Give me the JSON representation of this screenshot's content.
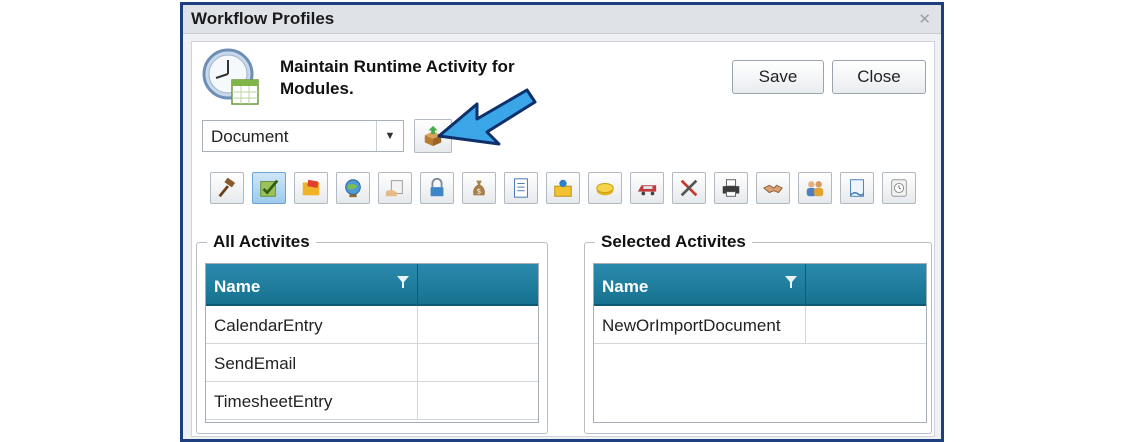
{
  "window": {
    "title": "Workflow Profiles",
    "close_symbol": "✕"
  },
  "header": {
    "title": "Maintain Runtime Activity for Modules."
  },
  "buttons": {
    "save": "Save",
    "close": "Close"
  },
  "module_select": {
    "value": "Document"
  },
  "toolbar": {
    "icons": [
      "gavel-icon",
      "checkbox-icon",
      "folder-icon",
      "globe-icon",
      "document-hand-icon",
      "lock-icon",
      "money-bag-icon",
      "document-icon",
      "mail-icon",
      "coins-icon",
      "train-icon",
      "tools-icon",
      "printer-icon",
      "handshake-icon",
      "people-icon",
      "certificate-icon",
      "clock-settings-icon"
    ]
  },
  "all_activities": {
    "title": "All Activites",
    "column": "Name",
    "rows": [
      "CalendarEntry",
      "SendEmail",
      "TimesheetEntry"
    ]
  },
  "selected_activities": {
    "title": "Selected Activites",
    "column": "Name",
    "rows": [
      "NewOrImportDocument"
    ]
  },
  "colors": {
    "header_accent": "#16728f",
    "arrow": "#3aa6e8",
    "window_border": "#1d3f7f"
  }
}
